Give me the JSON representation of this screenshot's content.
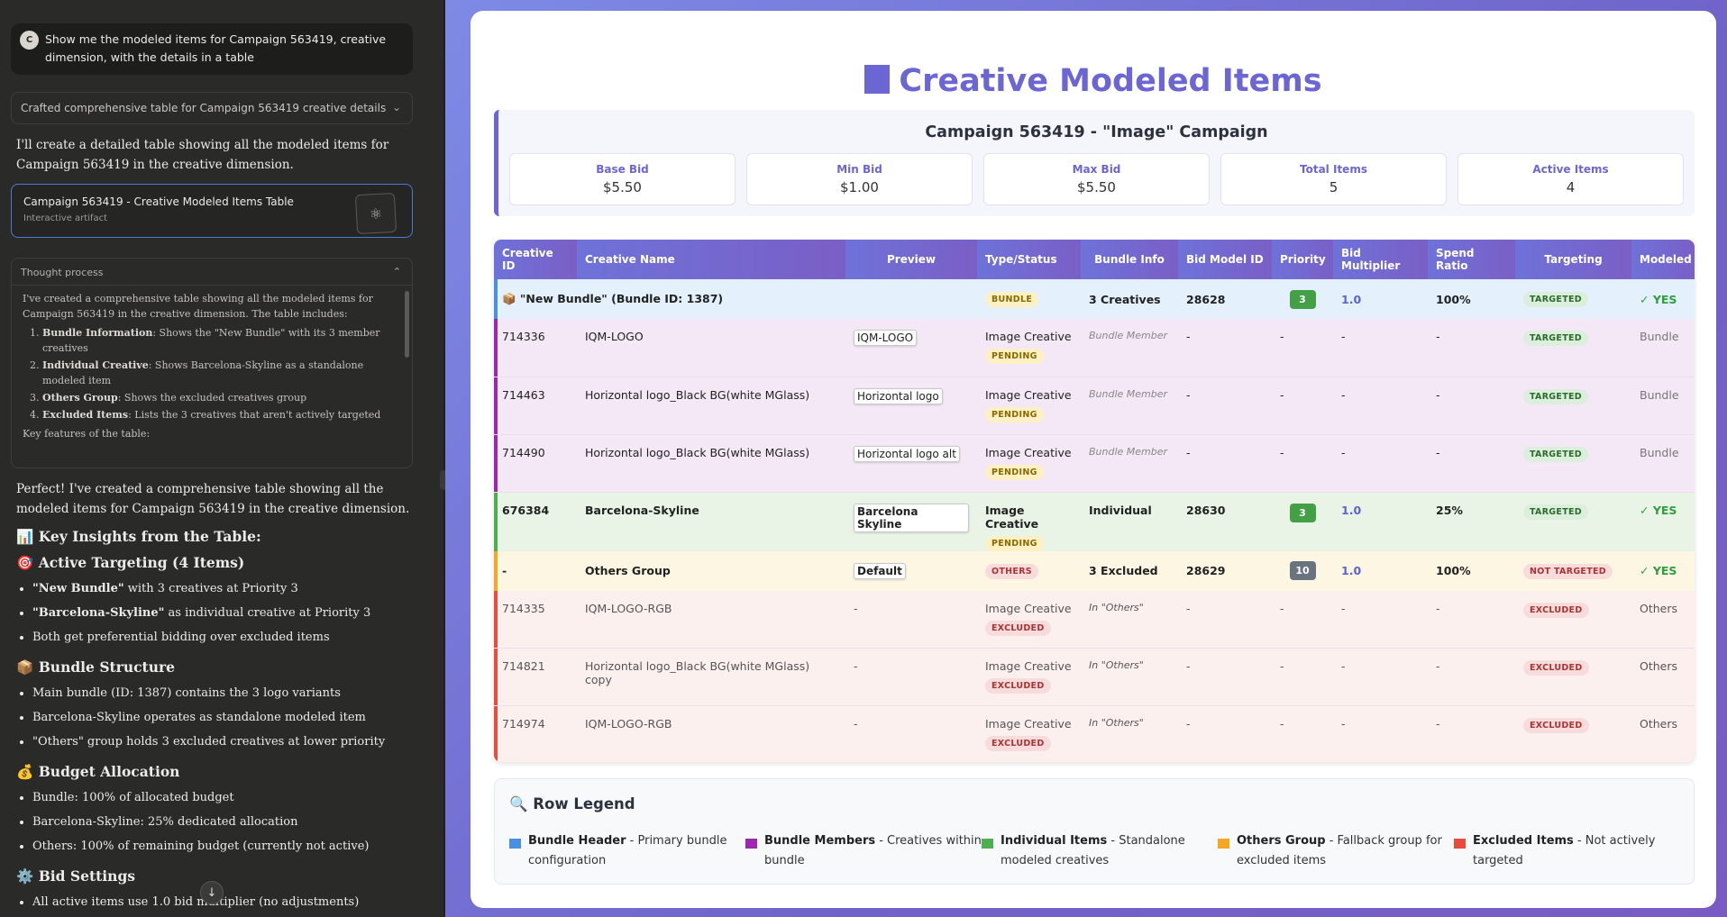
{
  "chat": {
    "user_initial": "C",
    "user_message": "Show me the modeled items for Campaign 563419, creative dimension, with the details in a table",
    "summary_row": "Crafted comprehensive table for Campaign 563419 creative details",
    "intro": "I'll create a detailed table showing all the modeled items for Campaign 563419 in the creative dimension.",
    "artifact": {
      "title": "Campaign 563419 - Creative Modeled Items Table",
      "subtitle": "Interactive artifact"
    },
    "thought": {
      "heading": "Thought process",
      "text": "I've created a comprehensive table showing all the modeled items for Campaign 563419 in the creative dimension. The table includes:",
      "items": [
        {
          "bold": "Bundle Information",
          "rest": ": Shows the \"New Bundle\" with its 3 member creatives"
        },
        {
          "bold": "Individual Creative",
          "rest": ": Shows Barcelona-Skyline as a standalone modeled item"
        },
        {
          "bold": "Others Group",
          "rest": ": Shows the excluded creatives group"
        },
        {
          "bold": "Excluded Items",
          "rest": ": Lists the 3 creatives that aren't actively targeted"
        }
      ],
      "footer": "Key features of the table:"
    },
    "answer_intro": "Perfect! I've created a comprehensive table showing all the modeled items for Campaign 563419 in the creative dimension.",
    "sections": [
      {
        "heading": "📊 Key Insights from the Table:",
        "bullets": []
      },
      {
        "heading": "🎯 Active Targeting (4 Items)",
        "bullets": [
          {
            "bold": "\"New Bundle\"",
            "rest": " with 3 creatives at Priority 3"
          },
          {
            "bold": "\"Barcelona-Skyline\"",
            "rest": " as individual creative at Priority 3"
          },
          {
            "bold": "",
            "rest": "Both get preferential bidding over excluded items"
          }
        ]
      },
      {
        "heading": "📦 Bundle Structure",
        "bullets": [
          {
            "bold": "",
            "rest": "Main bundle (ID: 1387) contains the 3 logo variants"
          },
          {
            "bold": "",
            "rest": "Barcelona-Skyline operates as standalone modeled item"
          },
          {
            "bold": "",
            "rest": "\"Others\" group holds 3 excluded creatives at lower priority"
          }
        ]
      },
      {
        "heading": "💰 Budget Allocation",
        "bullets": [
          {
            "bold": "",
            "rest": "Bundle: 100% of allocated budget"
          },
          {
            "bold": "",
            "rest": "Barcelona-Skyline: 25% dedicated allocation"
          },
          {
            "bold": "",
            "rest": "Others: 100% of remaining budget (currently not active)"
          }
        ]
      },
      {
        "heading": "⚙️ Bid Settings",
        "bullets": [
          {
            "bold": "",
            "rest": "All active items use 1.0 bid multiplier (no adjustments)"
          }
        ]
      }
    ]
  },
  "artifact_page": {
    "title": "Creative Modeled Items",
    "campaign_title": "Campaign 563419 - \"Image\" Campaign",
    "stats": [
      {
        "label": "Base Bid",
        "value": "$5.50"
      },
      {
        "label": "Min Bid",
        "value": "$1.00"
      },
      {
        "label": "Max Bid",
        "value": "$5.50"
      },
      {
        "label": "Total Items",
        "value": "5"
      },
      {
        "label": "Active Items",
        "value": "4"
      }
    ],
    "columns": [
      "Creative ID",
      "Creative Name",
      "Preview",
      "Type/Status",
      "Bundle Info",
      "Bid Model ID",
      "Priority",
      "Bid Multiplier",
      "Spend Ratio",
      "Targeting",
      "Modeled"
    ],
    "bundle_header": {
      "label": "📦 \"New Bundle\" (Bundle ID: 1387)",
      "type": "BUNDLE",
      "bundle_info": "3 Creatives",
      "bid_model": "28628",
      "priority": "3",
      "multiplier": "1.0",
      "spend": "100%",
      "targeting": "TARGETED",
      "modeled": "✓ YES"
    },
    "rows": [
      {
        "kind": "bm",
        "id": "714336",
        "name": "IQM-LOGO",
        "preview": "IQM-LOGO",
        "type": "Image Creative",
        "status": "PENDING",
        "bundle_info": "Bundle Member",
        "bid_model": "-",
        "priority": "-",
        "multiplier": "-",
        "spend": "-",
        "targeting": "TARGETED",
        "modeled": "Bundle"
      },
      {
        "kind": "bm",
        "id": "714463",
        "name": "Horizontal logo_Black BG(white MGlass)",
        "preview": "Horizontal logo",
        "type": "Image Creative",
        "status": "PENDING",
        "bundle_info": "Bundle Member",
        "bid_model": "-",
        "priority": "-",
        "multiplier": "-",
        "spend": "-",
        "targeting": "TARGETED",
        "modeled": "Bundle"
      },
      {
        "kind": "bm",
        "id": "714490",
        "name": "Horizontal logo_Black BG(white MGlass)",
        "preview": "Horizontal logo alt",
        "type": "Image Creative",
        "status": "PENDING",
        "bundle_info": "Bundle Member",
        "bid_model": "-",
        "priority": "-",
        "multiplier": "-",
        "spend": "-",
        "targeting": "TARGETED",
        "modeled": "Bundle"
      },
      {
        "kind": "in",
        "id": "676384",
        "name": "Barcelona-Skyline",
        "preview": "Barcelona Skyline",
        "type": "Image Creative",
        "status": "PENDING",
        "bundle_info": "Individual",
        "bid_model": "28630",
        "priority": "3",
        "multiplier": "1.0",
        "spend": "25%",
        "targeting": "TARGETED",
        "modeled": "✓ YES"
      },
      {
        "kind": "og",
        "id": "-",
        "name": "Others Group",
        "preview": "Default",
        "type": "OTHERS",
        "status": "",
        "bundle_info": "3 Excluded",
        "bid_model": "28629",
        "priority": "10",
        "multiplier": "1.0",
        "spend": "100%",
        "targeting": "NOT TARGETED",
        "modeled": "✓ YES"
      },
      {
        "kind": "ex",
        "id": "714335",
        "name": "IQM-LOGO-RGB",
        "preview": "-",
        "type": "Image Creative",
        "status": "EXCLUDED",
        "bundle_info": "In \"Others\"",
        "bid_model": "-",
        "priority": "-",
        "multiplier": "-",
        "spend": "-",
        "targeting": "EXCLUDED",
        "modeled": "Others"
      },
      {
        "kind": "ex",
        "id": "714821",
        "name": "Horizontal logo_Black BG(white MGlass) copy",
        "preview": "-",
        "type": "Image Creative",
        "status": "EXCLUDED",
        "bundle_info": "In \"Others\"",
        "bid_model": "-",
        "priority": "-",
        "multiplier": "-",
        "spend": "-",
        "targeting": "EXCLUDED",
        "modeled": "Others"
      },
      {
        "kind": "ex",
        "id": "714974",
        "name": "IQM-LOGO-RGB",
        "preview": "-",
        "type": "Image Creative",
        "status": "EXCLUDED",
        "bundle_info": "In \"Others\"",
        "bid_model": "-",
        "priority": "-",
        "multiplier": "-",
        "spend": "-",
        "targeting": "EXCLUDED",
        "modeled": "Others"
      }
    ],
    "legend": {
      "title": "🔍 Row Legend",
      "items": [
        {
          "bold": "Bundle Header",
          "rest": " - Primary bundle configuration",
          "color": "#4a90e2"
        },
        {
          "bold": "Bundle Members",
          "rest": " - Creatives within bundle",
          "color": "#9c27b0"
        },
        {
          "bold": "Individual Items",
          "rest": " - Standalone modeled creatives",
          "color": "#4caf50"
        },
        {
          "bold": "Others Group",
          "rest": " - Fallback group for excluded items",
          "color": "#f5a623"
        },
        {
          "bold": "Excluded Items",
          "rest": " - Not actively targeted",
          "color": "#e74c3c"
        }
      ]
    }
  }
}
